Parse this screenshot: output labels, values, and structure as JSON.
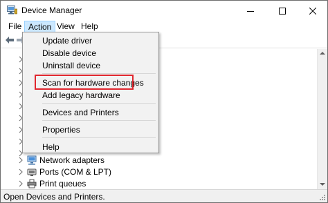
{
  "window": {
    "title": "Device Manager",
    "icons": {
      "app": "device-manager-icon",
      "minimize": "minimize-icon",
      "maximize": "maximize-icon",
      "close": "close-icon"
    }
  },
  "menubar": {
    "file": "File",
    "action": "Action",
    "view": "View",
    "help": "Help"
  },
  "toolbar": {
    "icons": [
      "back-arrow-icon",
      "forward-arrow-icon"
    ]
  },
  "action_menu": {
    "items": [
      {
        "label": "Update driver"
      },
      {
        "label": "Disable device"
      },
      {
        "label": "Uninstall device"
      },
      {
        "label": "Scan for hardware changes",
        "highlighted": true
      },
      {
        "label": "Add legacy hardware"
      },
      {
        "label": "Devices and Printers"
      },
      {
        "label": "Properties"
      },
      {
        "label": "Help"
      }
    ],
    "highlight_color": "#e0262e"
  },
  "tree": {
    "items": [
      {
        "label": "Network adapters",
        "icon": "network-adapter-icon"
      },
      {
        "label": "Ports (COM & LPT)",
        "icon": "port-icon"
      },
      {
        "label": "Print queues",
        "icon": "printer-icon"
      }
    ]
  },
  "statusbar": {
    "text": "Open Devices and Printers."
  },
  "colors": {
    "menu_selected_bg": "#cce8ff",
    "menu_selected_border": "#99d1ff",
    "dropdown_bg": "#f2f2f2"
  }
}
